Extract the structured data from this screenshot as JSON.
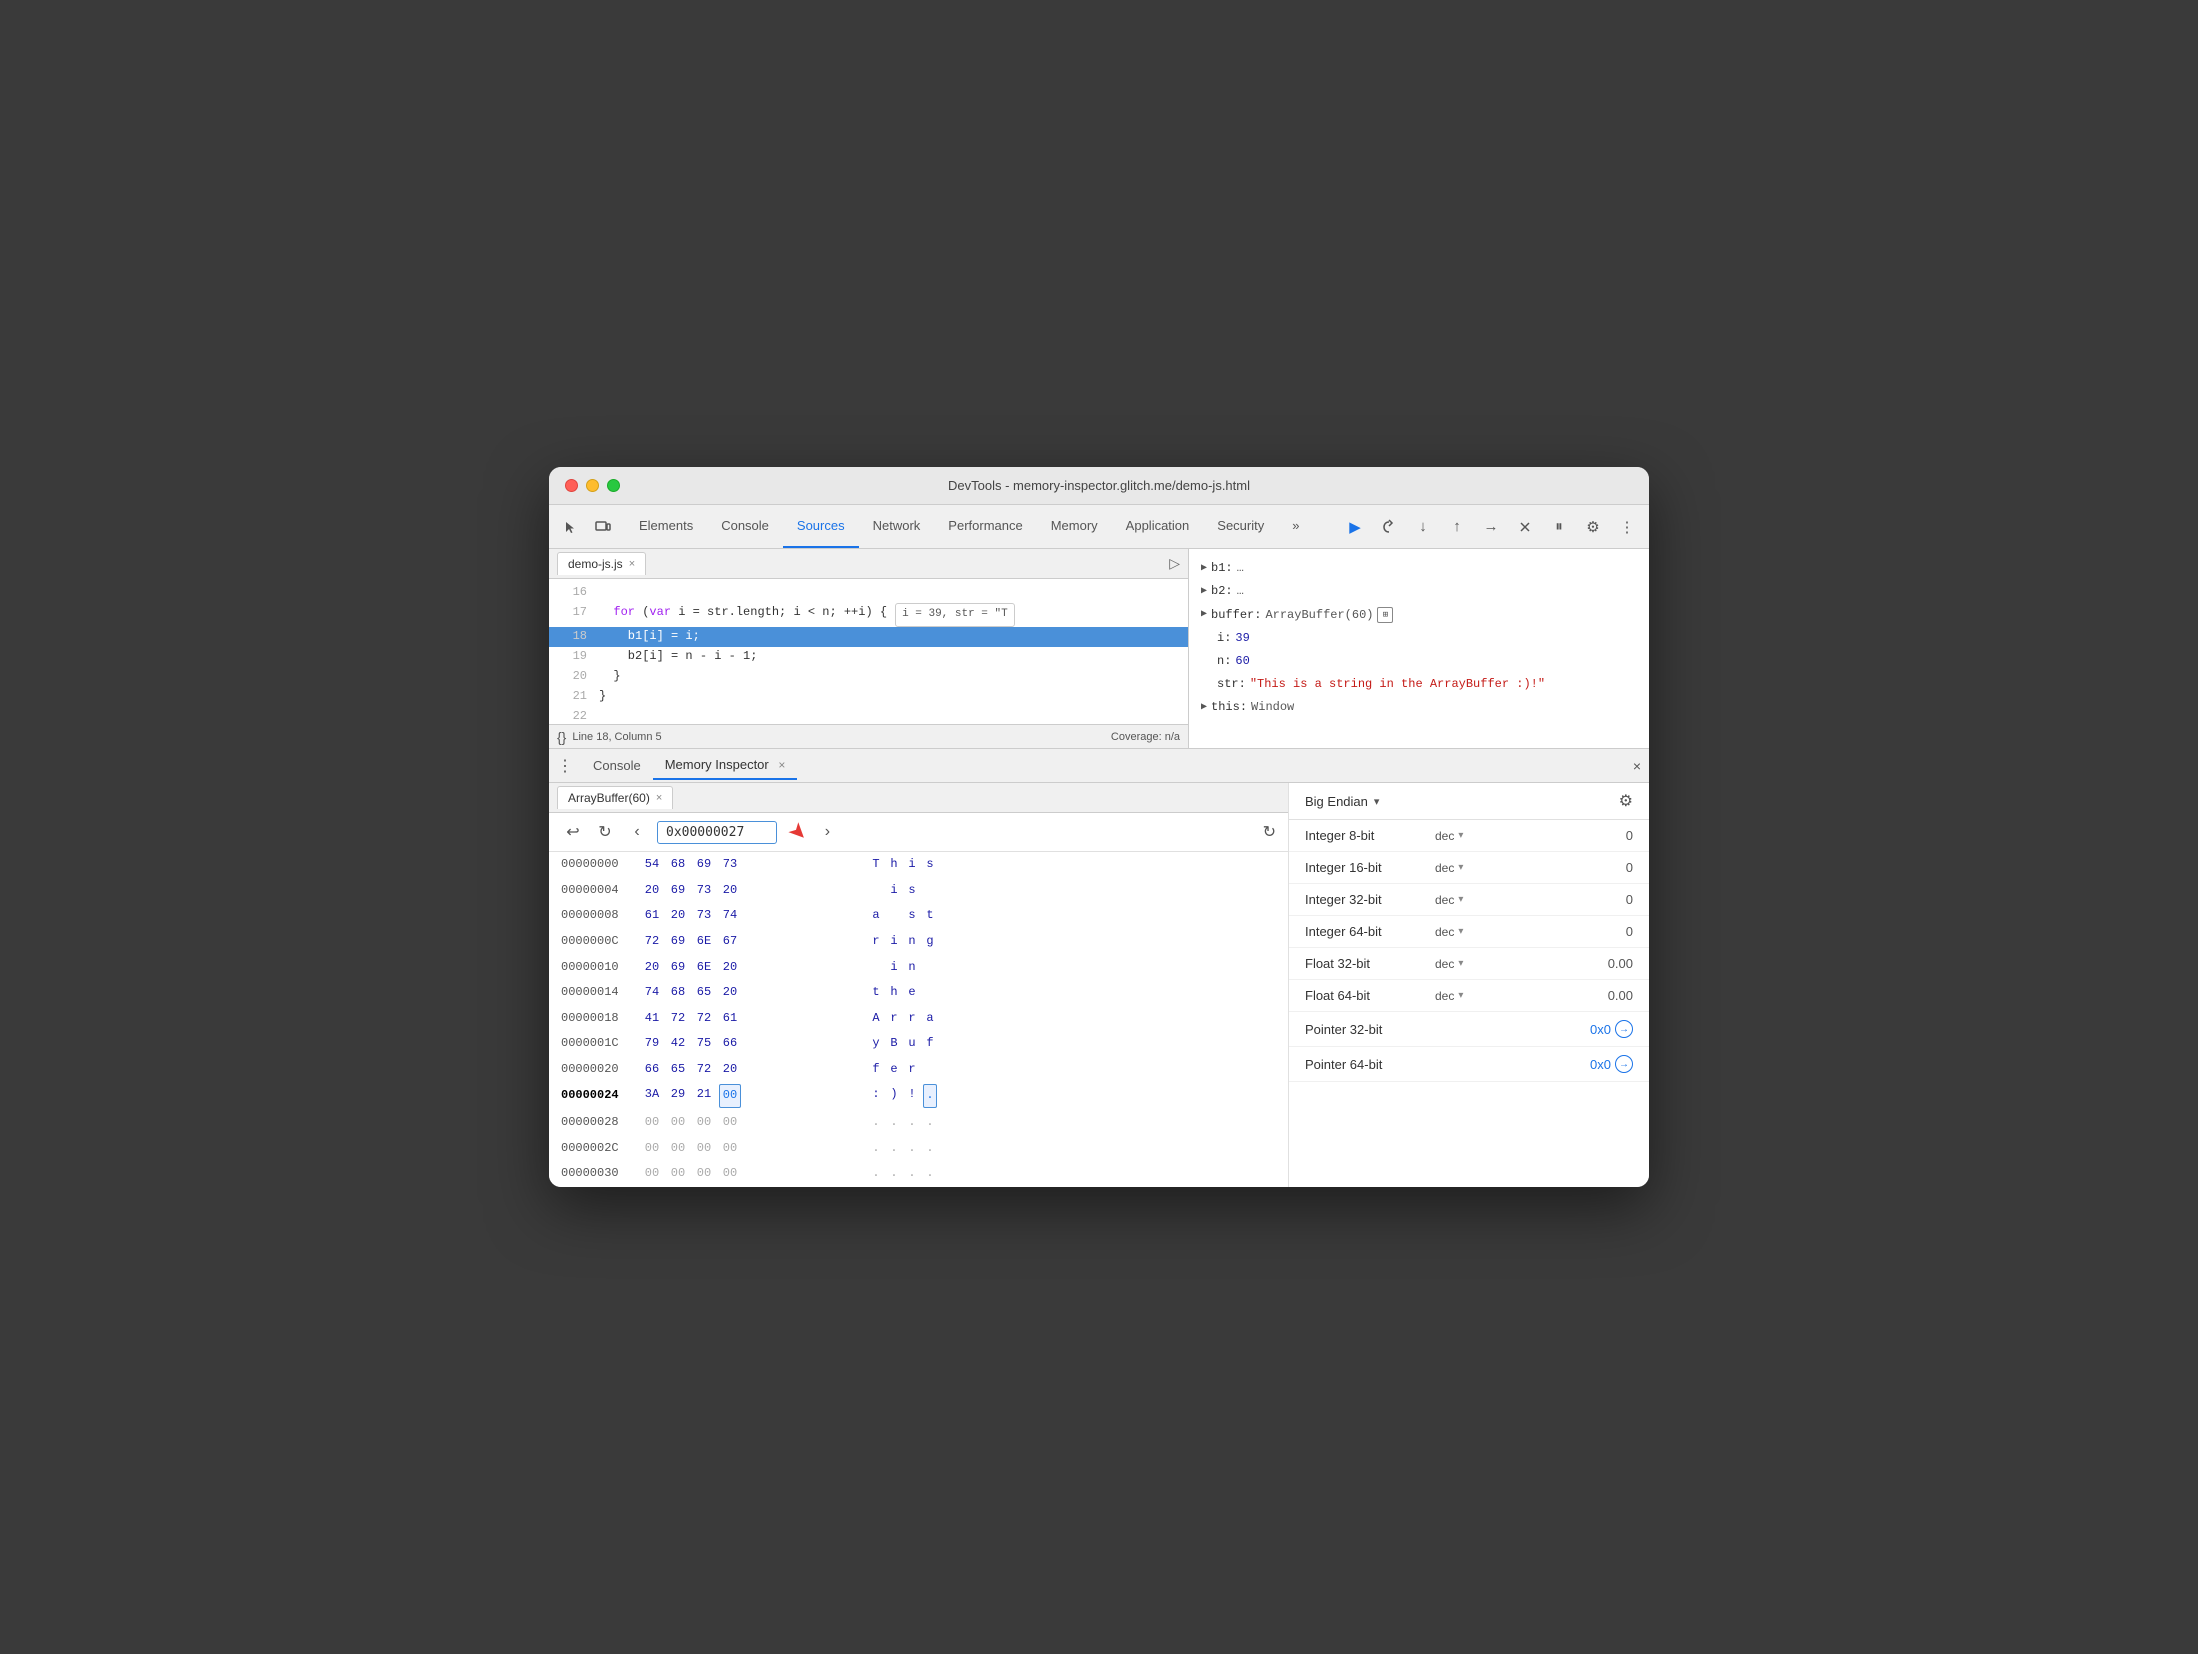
{
  "window": {
    "title": "DevTools - memory-inspector.glitch.me/demo-js.html"
  },
  "titlebar": {
    "traffic_lights": [
      "red",
      "yellow",
      "green"
    ]
  },
  "devtools_toolbar": {
    "tabs": [
      {
        "label": "Elements",
        "active": false
      },
      {
        "label": "Console",
        "active": false
      },
      {
        "label": "Sources",
        "active": true
      },
      {
        "label": "Network",
        "active": false
      },
      {
        "label": "Performance",
        "active": false
      },
      {
        "label": "Memory",
        "active": false
      },
      {
        "label": "Application",
        "active": false
      },
      {
        "label": "Security",
        "active": false
      }
    ],
    "more_tabs_label": "»"
  },
  "code_panel": {
    "file_tab": "demo-js.js",
    "lines": [
      {
        "num": "16",
        "code": ""
      },
      {
        "num": "17",
        "code": "  for (var i = str.length; i < n; ++i) {",
        "tooltip": "i = 39, str = \"T"
      },
      {
        "num": "18",
        "code": "    b1[i] = i;",
        "highlighted": true
      },
      {
        "num": "19",
        "code": "    b2[i] = n - i - 1;"
      },
      {
        "num": "20",
        "code": "  }"
      },
      {
        "num": "21",
        "code": "}"
      },
      {
        "num": "22",
        "code": ""
      }
    ],
    "status_line": "Line 18, Column 5",
    "status_coverage": "Coverage: n/a"
  },
  "scope_panel": {
    "items": [
      {
        "key": "b1:",
        "val": "…",
        "has_arrow": true
      },
      {
        "key": "b2:",
        "val": "…",
        "has_arrow": true
      },
      {
        "key": "buffer:",
        "val": "ArrayBuffer(60)",
        "has_arrow": true,
        "has_memory_icon": true
      },
      {
        "key": "i:",
        "val": "39",
        "type": "num",
        "indent": 1
      },
      {
        "key": "n:",
        "val": "60",
        "type": "num",
        "indent": 1
      },
      {
        "key": "str:",
        "val": "\"This is a string in the ArrayBuffer :)!\"",
        "type": "str",
        "indent": 1
      },
      {
        "key": "this:",
        "val": "Window",
        "has_arrow": true
      }
    ]
  },
  "bottom_panel": {
    "tabs": [
      {
        "label": "Console",
        "active": false
      },
      {
        "label": "Memory Inspector",
        "active": true
      }
    ],
    "close_label": "×"
  },
  "memory_inspector": {
    "buffer_tab": "ArrayBuffer(60)",
    "address_input": "0x00000027",
    "endian": "Big Endian",
    "hex_rows": [
      {
        "addr": "00000000",
        "bytes": [
          "54",
          "68",
          "69",
          "73"
        ],
        "chars": [
          "T",
          "h",
          "i",
          "s"
        ],
        "chars_type": [
          "str",
          "str",
          "str",
          "str"
        ]
      },
      {
        "addr": "00000004",
        "bytes": [
          "20",
          "69",
          "73",
          "20"
        ],
        "chars": [
          " ",
          "i",
          "s",
          " "
        ],
        "chars_type": [
          "dot",
          "str",
          "str",
          "dot"
        ]
      },
      {
        "addr": "00000008",
        "bytes": [
          "61",
          "20",
          "73",
          "74"
        ],
        "chars": [
          "a",
          " ",
          "s",
          "t"
        ],
        "chars_type": [
          "str",
          "dot",
          "str",
          "str"
        ]
      },
      {
        "addr": "0000000C",
        "bytes": [
          "72",
          "69",
          "6E",
          "67"
        ],
        "chars": [
          "r",
          "i",
          "n",
          "g"
        ],
        "chars_type": [
          "str",
          "str",
          "str",
          "str"
        ]
      },
      {
        "addr": "00000010",
        "bytes": [
          "20",
          "69",
          "6E",
          "20"
        ],
        "chars": [
          " ",
          "i",
          "n",
          " "
        ],
        "chars_type": [
          "dot",
          "str",
          "str",
          "dot"
        ]
      },
      {
        "addr": "00000014",
        "bytes": [
          "74",
          "68",
          "65",
          "20"
        ],
        "chars": [
          "t",
          "h",
          "e",
          " "
        ],
        "chars_type": [
          "str",
          "str",
          "str",
          "dot"
        ]
      },
      {
        "addr": "00000018",
        "bytes": [
          "41",
          "72",
          "72",
          "61"
        ],
        "chars": [
          "A",
          "r",
          "r",
          "a"
        ],
        "chars_type": [
          "str",
          "str",
          "str",
          "str"
        ]
      },
      {
        "addr": "0000001C",
        "bytes": [
          "79",
          "42",
          "75",
          "66"
        ],
        "chars": [
          "y",
          "B",
          "u",
          "f"
        ],
        "chars_type": [
          "str",
          "str",
          "str",
          "str"
        ]
      },
      {
        "addr": "00000020",
        "bytes": [
          "66",
          "65",
          "72",
          "20"
        ],
        "chars": [
          "f",
          "e",
          "r",
          " "
        ],
        "chars_type": [
          "str",
          "str",
          "str",
          "dot"
        ]
      },
      {
        "addr": "00000024",
        "bytes": [
          "3A",
          "29",
          "21",
          "00"
        ],
        "chars": [
          ":",
          ")",
          "!",
          "."
        ],
        "chars_type": [
          "str",
          "str",
          "str",
          "selected"
        ],
        "current": true,
        "selected_byte_idx": 3
      },
      {
        "addr": "00000028",
        "bytes": [
          "00",
          "00",
          "00",
          "00"
        ],
        "chars": [
          ".",
          ".",
          ".",
          "."
        ],
        "chars_type": [
          "dot",
          "dot",
          "dot",
          "dot"
        ]
      },
      {
        "addr": "0000002C",
        "bytes": [
          "00",
          "00",
          "00",
          "00"
        ],
        "chars": [
          ".",
          ".",
          ".",
          "."
        ],
        "chars_type": [
          "dot",
          "dot",
          "dot",
          "dot"
        ]
      },
      {
        "addr": "00000030",
        "bytes": [
          "00",
          "00",
          "00",
          "00"
        ],
        "chars": [
          ".",
          ".",
          ".",
          "."
        ],
        "chars_type": [
          "dot",
          "dot",
          "dot",
          "dot"
        ]
      }
    ],
    "inspector": {
      "endian_label": "Big Endian",
      "rows": [
        {
          "label": "Integer 8-bit",
          "format": "dec",
          "value": "0"
        },
        {
          "label": "Integer 16-bit",
          "format": "dec",
          "value": "0"
        },
        {
          "label": "Integer 32-bit",
          "format": "dec",
          "value": "0"
        },
        {
          "label": "Integer 64-bit",
          "format": "dec",
          "value": "0"
        },
        {
          "label": "Float 32-bit",
          "format": "dec",
          "value": "0.00"
        },
        {
          "label": "Float 64-bit",
          "format": "dec",
          "value": "0.00"
        },
        {
          "label": "Pointer 32-bit",
          "format": "",
          "value": "0x0",
          "is_link": true
        },
        {
          "label": "Pointer 64-bit",
          "format": "",
          "value": "0x0",
          "is_link": true
        }
      ]
    }
  }
}
